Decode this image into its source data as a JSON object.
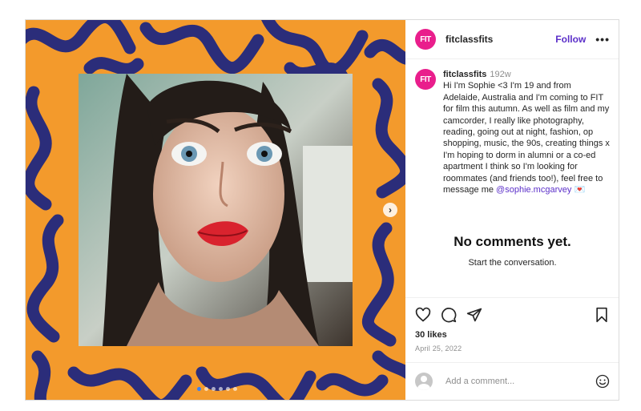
{
  "account": {
    "avatar_text": "FIT",
    "username": "fitclassfits",
    "follow_label": "Follow",
    "more_label": "•••"
  },
  "caption": {
    "username": "fitclassfits",
    "age": "192w",
    "text": "Hi I'm Sophie <3 I'm 19 and from Adelaide, Australia and I'm coming to FIT for film this autumn. As well as film and my camcorder, I really like photography, reading, going out at night, fashion, op shopping, music, the 90s, creating things x I'm hoping to dorm in alumni or a co-ed apartment I think so I'm looking for roommates (and friends too!), feel free to message me",
    "mention": "@sophie.mcgarvey",
    "emoji": "💌"
  },
  "comments_empty": {
    "title": "No comments yet.",
    "subtitle": "Start the conversation."
  },
  "engagement": {
    "likes": "30 likes",
    "date": "April 25, 2022"
  },
  "comment_box": {
    "placeholder": "Add a comment..."
  },
  "carousel": {
    "next_label": "›",
    "slide_count": 6,
    "active_index": 0
  },
  "colors": {
    "frame_orange": "#f39a2c",
    "squiggle_navy": "#2b2d7a",
    "avatar_pink": "#e91e8c",
    "link_purple": "#5b2fc9"
  },
  "icons": [
    "heart-icon",
    "comment-icon",
    "share-icon",
    "bookmark-icon",
    "emoji-icon",
    "next-arrow-icon"
  ]
}
